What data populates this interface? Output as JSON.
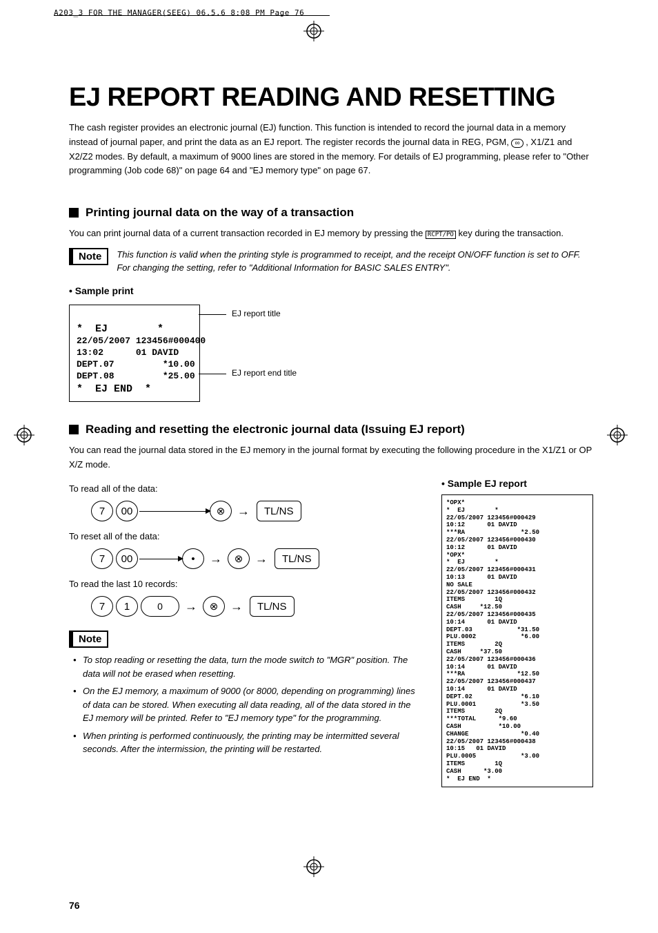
{
  "page_header": "A203_3 FOR THE MANAGER(SEEG)  06.5.6 8:08 PM  Page 76",
  "title": "EJ REPORT READING AND RESETTING",
  "intro": "The cash register provides an electronic journal (EJ) function.  This function is intended to record the journal data in a memory instead of journal paper, and print the data as an EJ report.  The register records the journal data in REG, PGM,  ",
  "intro_icon": "loop-icon",
  "intro_cont": " , X1/Z1 and X2/Z2 modes.  By default, a maximum of 9000 lines are stored in the memory.  For details of EJ programming, please refer to \"Other programming (Job code 68)\" on page 64 and \"EJ memory type\" on page 67.",
  "section1": {
    "title": "Printing journal data on the way of a transaction",
    "text1": "You can print journal data of a current transaction recorded in EJ memory by pressing the ",
    "key_label": "RCPT/PO",
    "text2": " key during the transaction.",
    "note_label": "Note",
    "note_text": "This function is valid when the printing style is programmed to receipt, and the receipt ON/OFF function is set to OFF.  For changing the setting, refer to \"Additional Information for BASIC SALES ENTRY\".",
    "sample_label": "• Sample print",
    "receipt": {
      "line1_bold": "*  EJ        *",
      "line2": "22/05/2007 123456#000400",
      "line3": "13:02      01 DAVID",
      "line4": "DEPT.07         *10.00",
      "line5": "DEPT.08         *25.00",
      "line6_bold": "*  EJ END  *"
    },
    "callout1": "EJ report title",
    "callout2": "EJ report end title"
  },
  "section2": {
    "title": "Reading and resetting the electronic journal data (Issuing EJ report)",
    "text": "You can read the journal data stored in the EJ memory in the journal format by executing the following procedure in the X1/Z1 or OP X/Z mode.",
    "read_all": "To read all of the data:",
    "reset_all": "To reset all of the data:",
    "read_last": "To read the last 10 records:",
    "sample_label": "• Sample EJ report",
    "keys": {
      "seven": "7",
      "zero_zero": "00",
      "one": "1",
      "zero": "0",
      "dot": "•",
      "multiply": "⊗",
      "tlns": "TL/NS"
    },
    "note_label": "Note",
    "notes": [
      "To stop reading or resetting the data, turn the mode switch to \"MGR\" position.  The data will not be erased when resetting.",
      "On the EJ memory, a maximum of 9000 (or 8000, depending on programming) lines of data can be stored.  When executing all data reading, all of the data stored in the EJ memory will be printed.  Refer to \"EJ memory type\" for the programming.",
      "When printing is performed continuously, the printing may be intermitted several seconds.  After the intermission, the printing will be restarted."
    ],
    "ej_report": "*OPX*\n*  EJ        *\n22/05/2007 123456#000429\n10:12      01 DAVID\n***RA               *2.50\n22/05/2007 123456#000430\n10:12      01 DAVID\n*OPX*\n*  EJ        *\n22/05/2007 123456#000431\n10:13      01 DAVID\nNO SALE\n22/05/2007 123456#000432\nITEMS        1Q\nCASH     *12.50\n22/05/2007 123456#000435\n10:14      01 DAVID\nDEPT.03            *31.50\nPLU.0002            *6.00\nITEMS        2Q\nCASH     *37.50\n22/05/2007 123456#000436\n10:14      01 DAVID\n***RA              *12.50\n22/05/2007 123456#000437\n10:14      01 DAVID\nDEPT.02             *6.10\nPLU.0001            *3.50\nITEMS        2Q\n***TOTAL      *9.60\nCASH          *10.00\nCHANGE              *0.40\n22/05/2007 123456#000438\n10:15   01 DAVID\nPLU.0005            *3.00\nITEMS        1Q\nCASH      *3.00\n*  EJ END  *"
  },
  "page_num": "76"
}
